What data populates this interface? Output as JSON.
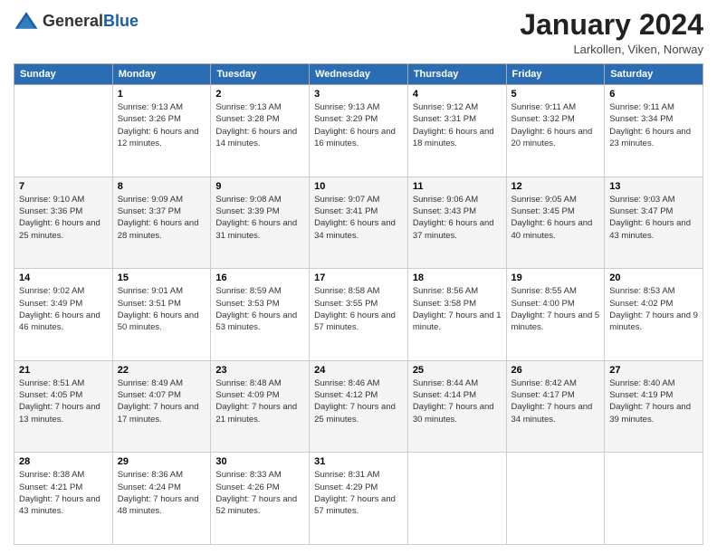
{
  "header": {
    "logo_general": "General",
    "logo_blue": "Blue",
    "month_title": "January 2024",
    "location": "Larkollen, Viken, Norway"
  },
  "days": [
    "Sunday",
    "Monday",
    "Tuesday",
    "Wednesday",
    "Thursday",
    "Friday",
    "Saturday"
  ],
  "weeks": [
    [
      {
        "date": "",
        "sunrise": "",
        "sunset": "",
        "daylight": ""
      },
      {
        "date": "1",
        "sunrise": "9:13 AM",
        "sunset": "3:26 PM",
        "daylight": "6 hours and 12 minutes."
      },
      {
        "date": "2",
        "sunrise": "9:13 AM",
        "sunset": "3:28 PM",
        "daylight": "6 hours and 14 minutes."
      },
      {
        "date": "3",
        "sunrise": "9:13 AM",
        "sunset": "3:29 PM",
        "daylight": "6 hours and 16 minutes."
      },
      {
        "date": "4",
        "sunrise": "9:12 AM",
        "sunset": "3:31 PM",
        "daylight": "6 hours and 18 minutes."
      },
      {
        "date": "5",
        "sunrise": "9:11 AM",
        "sunset": "3:32 PM",
        "daylight": "6 hours and 20 minutes."
      },
      {
        "date": "6",
        "sunrise": "9:11 AM",
        "sunset": "3:34 PM",
        "daylight": "6 hours and 23 minutes."
      }
    ],
    [
      {
        "date": "7",
        "sunrise": "9:10 AM",
        "sunset": "3:36 PM",
        "daylight": "6 hours and 25 minutes."
      },
      {
        "date": "8",
        "sunrise": "9:09 AM",
        "sunset": "3:37 PM",
        "daylight": "6 hours and 28 minutes."
      },
      {
        "date": "9",
        "sunrise": "9:08 AM",
        "sunset": "3:39 PM",
        "daylight": "6 hours and 31 minutes."
      },
      {
        "date": "10",
        "sunrise": "9:07 AM",
        "sunset": "3:41 PM",
        "daylight": "6 hours and 34 minutes."
      },
      {
        "date": "11",
        "sunrise": "9:06 AM",
        "sunset": "3:43 PM",
        "daylight": "6 hours and 37 minutes."
      },
      {
        "date": "12",
        "sunrise": "9:05 AM",
        "sunset": "3:45 PM",
        "daylight": "6 hours and 40 minutes."
      },
      {
        "date": "13",
        "sunrise": "9:03 AM",
        "sunset": "3:47 PM",
        "daylight": "6 hours and 43 minutes."
      }
    ],
    [
      {
        "date": "14",
        "sunrise": "9:02 AM",
        "sunset": "3:49 PM",
        "daylight": "6 hours and 46 minutes."
      },
      {
        "date": "15",
        "sunrise": "9:01 AM",
        "sunset": "3:51 PM",
        "daylight": "6 hours and 50 minutes."
      },
      {
        "date": "16",
        "sunrise": "8:59 AM",
        "sunset": "3:53 PM",
        "daylight": "6 hours and 53 minutes."
      },
      {
        "date": "17",
        "sunrise": "8:58 AM",
        "sunset": "3:55 PM",
        "daylight": "6 hours and 57 minutes."
      },
      {
        "date": "18",
        "sunrise": "8:56 AM",
        "sunset": "3:58 PM",
        "daylight": "7 hours and 1 minute."
      },
      {
        "date": "19",
        "sunrise": "8:55 AM",
        "sunset": "4:00 PM",
        "daylight": "7 hours and 5 minutes."
      },
      {
        "date": "20",
        "sunrise": "8:53 AM",
        "sunset": "4:02 PM",
        "daylight": "7 hours and 9 minutes."
      }
    ],
    [
      {
        "date": "21",
        "sunrise": "8:51 AM",
        "sunset": "4:05 PM",
        "daylight": "7 hours and 13 minutes."
      },
      {
        "date": "22",
        "sunrise": "8:49 AM",
        "sunset": "4:07 PM",
        "daylight": "7 hours and 17 minutes."
      },
      {
        "date": "23",
        "sunrise": "8:48 AM",
        "sunset": "4:09 PM",
        "daylight": "7 hours and 21 minutes."
      },
      {
        "date": "24",
        "sunrise": "8:46 AM",
        "sunset": "4:12 PM",
        "daylight": "7 hours and 25 minutes."
      },
      {
        "date": "25",
        "sunrise": "8:44 AM",
        "sunset": "4:14 PM",
        "daylight": "7 hours and 30 minutes."
      },
      {
        "date": "26",
        "sunrise": "8:42 AM",
        "sunset": "4:17 PM",
        "daylight": "7 hours and 34 minutes."
      },
      {
        "date": "27",
        "sunrise": "8:40 AM",
        "sunset": "4:19 PM",
        "daylight": "7 hours and 39 minutes."
      }
    ],
    [
      {
        "date": "28",
        "sunrise": "8:38 AM",
        "sunset": "4:21 PM",
        "daylight": "7 hours and 43 minutes."
      },
      {
        "date": "29",
        "sunrise": "8:36 AM",
        "sunset": "4:24 PM",
        "daylight": "7 hours and 48 minutes."
      },
      {
        "date": "30",
        "sunrise": "8:33 AM",
        "sunset": "4:26 PM",
        "daylight": "7 hours and 52 minutes."
      },
      {
        "date": "31",
        "sunrise": "8:31 AM",
        "sunset": "4:29 PM",
        "daylight": "7 hours and 57 minutes."
      },
      {
        "date": "",
        "sunrise": "",
        "sunset": "",
        "daylight": ""
      },
      {
        "date": "",
        "sunrise": "",
        "sunset": "",
        "daylight": ""
      },
      {
        "date": "",
        "sunrise": "",
        "sunset": "",
        "daylight": ""
      }
    ]
  ],
  "labels": {
    "sunrise_prefix": "Sunrise: ",
    "sunset_prefix": "Sunset: ",
    "daylight_prefix": "Daylight: "
  }
}
